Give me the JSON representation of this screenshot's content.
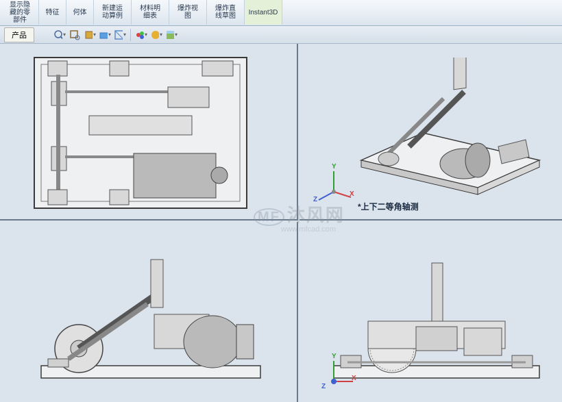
{
  "ribbon": {
    "items": [
      {
        "label": "显示隐\n藏的零\n部件"
      },
      {
        "label": "特征"
      },
      {
        "label": "何体"
      },
      {
        "label": "新建运\n动算例"
      },
      {
        "label": "材料明\n细表"
      },
      {
        "label": "爆炸视\n图"
      },
      {
        "label": "爆炸直\n线草图"
      },
      {
        "label": "Instant3D"
      }
    ]
  },
  "toolbar": {
    "tab_label": "产品"
  },
  "viewport": {
    "iso_label": "*上下二等角轴测"
  },
  "axes": {
    "x": "X",
    "y": "Y",
    "z": "Z"
  },
  "watermark": {
    "main": "沐风网",
    "url": "www.mfcad.com"
  }
}
